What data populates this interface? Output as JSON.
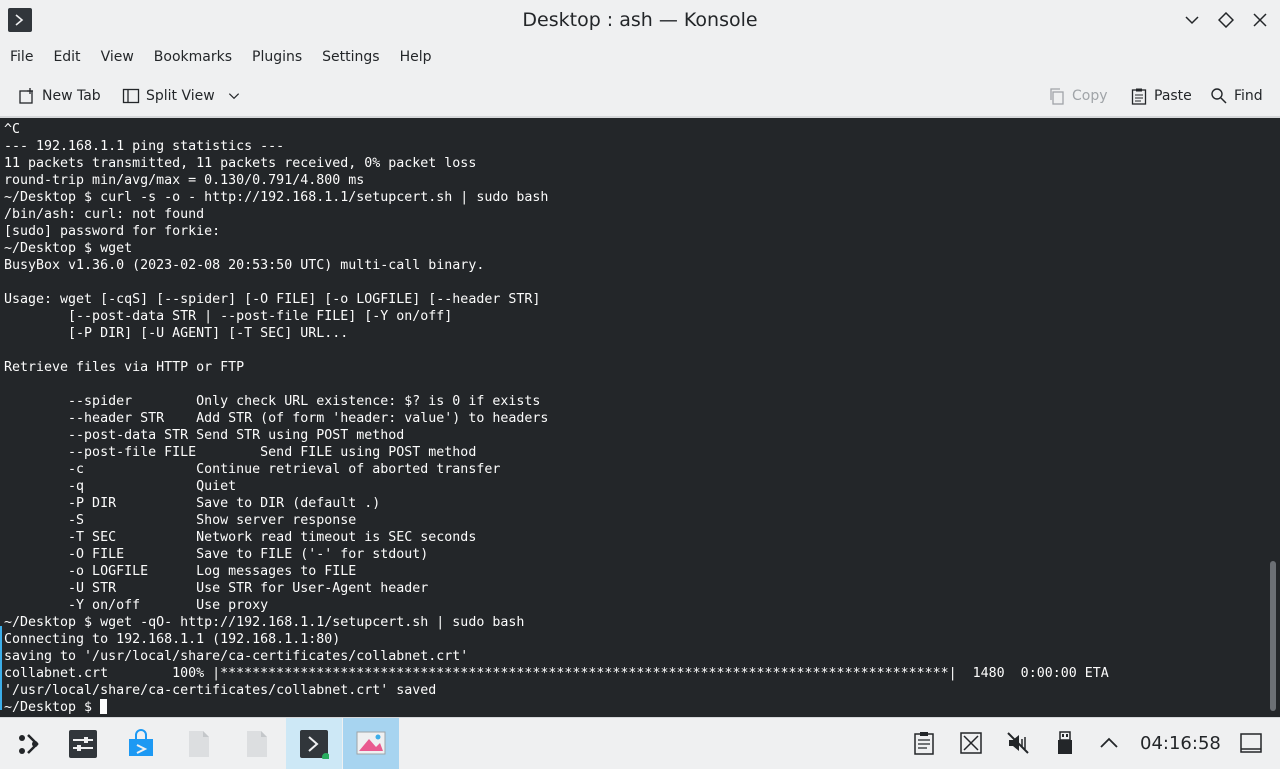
{
  "window": {
    "title": "Desktop : ash — Konsole"
  },
  "menu": [
    "File",
    "Edit",
    "View",
    "Bookmarks",
    "Plugins",
    "Settings",
    "Help"
  ],
  "toolbar": {
    "new_tab": "New Tab",
    "split_view": "Split View",
    "copy": "Copy",
    "paste": "Paste",
    "find": "Find"
  },
  "terminal": {
    "lines": [
      "^C",
      "--- 192.168.1.1 ping statistics ---",
      "11 packets transmitted, 11 packets received, 0% packet loss",
      "round-trip min/avg/max = 0.130/0.791/4.800 ms",
      "~/Desktop $ curl -s -o - http://192.168.1.1/setupcert.sh | sudo bash",
      "/bin/ash: curl: not found",
      "[sudo] password for forkie:",
      "~/Desktop $ wget",
      "BusyBox v1.36.0 (2023-02-08 20:53:50 UTC) multi-call binary.",
      "",
      "Usage: wget [-cqS] [--spider] [-O FILE] [-o LOGFILE] [--header STR]",
      "        [--post-data STR | --post-file FILE] [-Y on/off]",
      "        [-P DIR] [-U AGENT] [-T SEC] URL...",
      "",
      "Retrieve files via HTTP or FTP",
      "",
      "        --spider        Only check URL existence: $? is 0 if exists",
      "        --header STR    Add STR (of form 'header: value') to headers",
      "        --post-data STR Send STR using POST method",
      "        --post-file FILE        Send FILE using POST method",
      "        -c              Continue retrieval of aborted transfer",
      "        -q              Quiet",
      "        -P DIR          Save to DIR (default .)",
      "        -S              Show server response",
      "        -T SEC          Network read timeout is SEC seconds",
      "        -O FILE         Save to FILE ('-' for stdout)",
      "        -o LOGFILE      Log messages to FILE",
      "        -U STR          Use STR for User-Agent header",
      "        -Y on/off       Use proxy",
      "~/Desktop $ wget -qO- http://192.168.1.1/setupcert.sh | sudo bash",
      "Connecting to 192.168.1.1 (192.168.1.1:80)",
      "saving to '/usr/local/share/ca-certificates/collabnet.crt'",
      "collabnet.crt        100% |*******************************************************************************************|  1480  0:00:00 ETA",
      "'/usr/local/share/ca-certificates/collabnet.crt' saved"
    ],
    "prompt": "~/Desktop $ "
  },
  "taskbar": {
    "clock": "04:16:58"
  },
  "icons": {
    "app": "konsole-icon",
    "launcher": "plasma-launcher-icon",
    "settings": "system-settings-icon",
    "store": "discover-store-icon",
    "file1": "document-icon",
    "file2": "document-icon",
    "konsole_task": "konsole-icon",
    "image_task": "image-viewer-icon",
    "clipboard": "clipboard-icon",
    "screenshot": "screenshot-icon",
    "volume": "volume-muted-icon",
    "usb": "usb-device-icon",
    "tray_expand": "chevron-up-icon",
    "desktop": "show-desktop-icon"
  },
  "colors": {
    "terminal_bg": "#232629",
    "terminal_fg": "#fcfcfc",
    "accent": "#3daee9"
  }
}
